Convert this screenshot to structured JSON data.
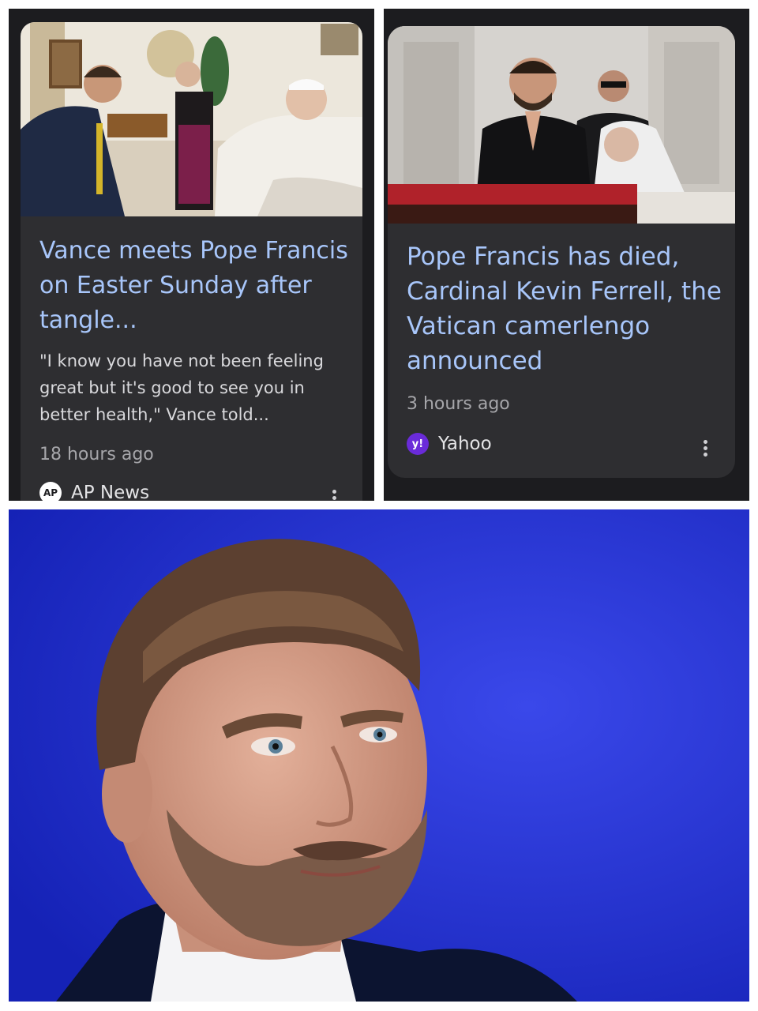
{
  "cards": [
    {
      "headline": "Vance meets Pope Francis on Easter Sunday after tangle...",
      "snippet": "\"I know you have not been feeling great but it's good to see you in better health,\" Vance told...",
      "age": "18 hours ago",
      "source": "AP News",
      "source_icon": "ap-logo-icon",
      "source_icon_text": "AP"
    },
    {
      "headline": "Pope Francis has died, Cardinal Kevin Ferrell, the Vatican camerlengo announced",
      "age": "3 hours ago",
      "source": "Yahoo",
      "source_icon": "yahoo-logo-icon",
      "source_icon_text": "y!"
    }
  ],
  "colors": {
    "headline": "#a8c6fa",
    "card_bg": "#2e2e31",
    "panel_bg": "#1c1c1f",
    "portrait_bg": "#1e2ad0"
  }
}
